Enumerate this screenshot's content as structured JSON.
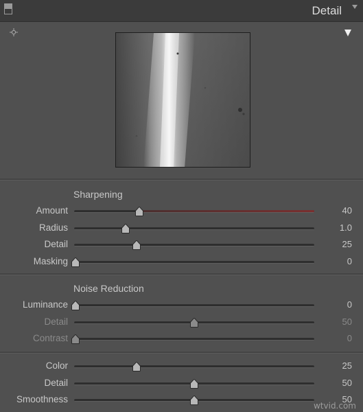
{
  "header": {
    "title": "Detail"
  },
  "icons": {
    "collapse": "panel-collapse-icon",
    "menu": "chevron-down-icon",
    "target": "crosshair-target-icon",
    "warning": "triangle-warning-icon"
  },
  "sharpening": {
    "title": "Sharpening",
    "sliders": [
      {
        "label": "Amount",
        "value": "40",
        "fraction": 0.27,
        "active_color": "#7a2f2f"
      },
      {
        "label": "Radius",
        "value": "1.0",
        "fraction": 0.215
      },
      {
        "label": "Detail",
        "value": "25",
        "fraction": 0.26
      },
      {
        "label": "Masking",
        "value": "0",
        "fraction": 0.0
      }
    ]
  },
  "noise_reduction": {
    "title": "Noise Reduction",
    "sliders": [
      {
        "label": "Luminance",
        "value": "0",
        "fraction": 0.0
      },
      {
        "label": "Detail",
        "value": "50",
        "fraction": 0.5,
        "disabled": true
      },
      {
        "label": "Contrast",
        "value": "0",
        "fraction": 0.0,
        "disabled": true
      }
    ],
    "color_sliders": [
      {
        "label": "Color",
        "value": "25",
        "fraction": 0.26
      },
      {
        "label": "Detail",
        "value": "50",
        "fraction": 0.5
      },
      {
        "label": "Smoothness",
        "value": "50",
        "fraction": 0.5
      }
    ]
  },
  "watermark": "wtvid.com",
  "colors": {
    "panel_bg": "#505050",
    "header_bg": "#3b3b3b",
    "text": "#c8c8c8",
    "dim_text": "#8a8a8a"
  }
}
